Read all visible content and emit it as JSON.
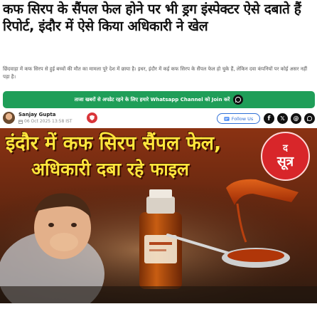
{
  "article": {
    "headline": "कफ सिरप के सैंपल फेल होने पर भी ड्रग इंस्पेक्टर ऐसे दबाते हैं रिपोर्ट, इंदौर में ऐसे किया अधिकारी ने खेल",
    "summary": "छिंदवाड़ा में कफ सिरप से हुई बच्चों की मौत का मामला पूरे देश में छाया है। इधर, इंदौर में कई कफ सिरप के सैंपल फेल हो चुके हैं, लेकिन दवा कंपनियों पर कोई असर नहीं पड़ा है।"
  },
  "whatsapp": {
    "label": "ताजा खबरों से अपडेट रहने के लिए हमारे Whatsapp Channel को Join करें",
    "icon": "whatsapp-icon"
  },
  "author": {
    "name": "Sanjay Gupta",
    "date": "06 Oct 2025 13:58 IST",
    "avatar_icon": "avatar"
  },
  "actions": {
    "follow_label": "Follow Us",
    "social": [
      "facebook-icon",
      "x-icon",
      "threads-icon",
      "whatsapp-icon"
    ]
  },
  "hero": {
    "line1": "इंदौर में कफ सिरप सैंपल फेल,",
    "line2": "अधिकारी दबा रहे फाइल",
    "logo_top": "द",
    "logo_main": "सूत्र"
  },
  "colors": {
    "whatsapp_green": "#1f9e58",
    "hero_text": "#ffe63c",
    "logo_red": "#d8262a",
    "follow_blue": "#2f6fd6"
  }
}
